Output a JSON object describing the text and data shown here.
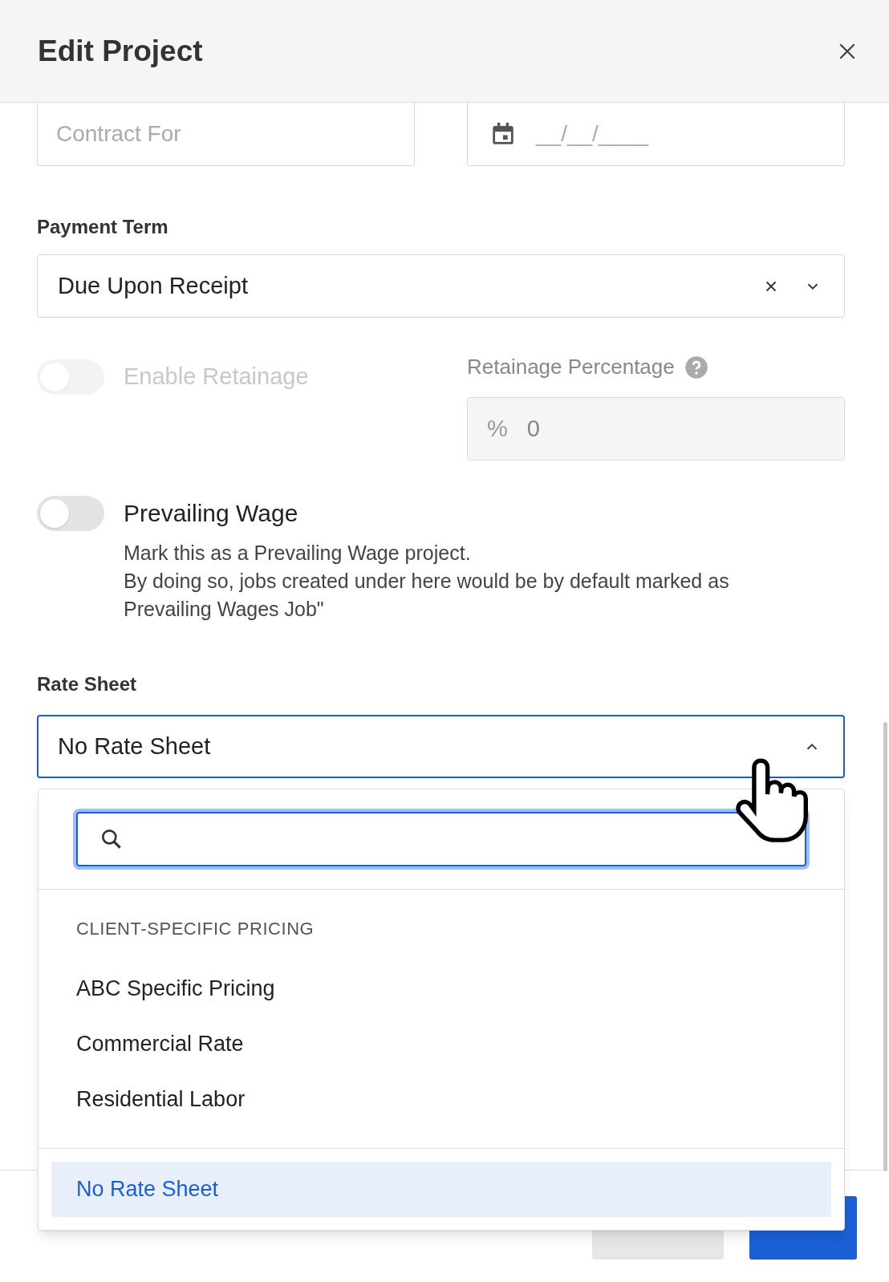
{
  "dialog": {
    "title": "Edit Project"
  },
  "contract_for": {
    "placeholder": "Contract For"
  },
  "date": {
    "placeholder": "__/__/____"
  },
  "payment_term": {
    "label": "Payment Term",
    "value": "Due Upon Receipt"
  },
  "retainage": {
    "label": "Enable Retainage",
    "on": false,
    "disabled": true
  },
  "retainage_percentage": {
    "label": "Retainage Percentage",
    "prefix": "%",
    "value": "0"
  },
  "prevailing_wage": {
    "label": "Prevailing Wage",
    "on": false,
    "description": [
      "Mark this as a Prevailing Wage project.",
      "By doing so, jobs created under here would be by default marked as Prevailing Wages Job\""
    ]
  },
  "rate_sheet": {
    "label": "Rate Sheet",
    "value": "No Rate Sheet",
    "expanded": true
  },
  "dropdown": {
    "groups": [
      {
        "heading": "CLIENT-SPECIFIC PRICING",
        "items": [
          {
            "label": "ABC Specific Pricing",
            "selected": false
          },
          {
            "label": "Commercial Rate",
            "selected": false
          },
          {
            "label": "Residential Labor",
            "selected": false
          }
        ]
      },
      {
        "items": [
          {
            "label": "No Rate Sheet",
            "selected": true
          }
        ]
      }
    ]
  },
  "buttons": [
    {
      "kind": "secondary"
    },
    {
      "kind": "primary"
    }
  ]
}
